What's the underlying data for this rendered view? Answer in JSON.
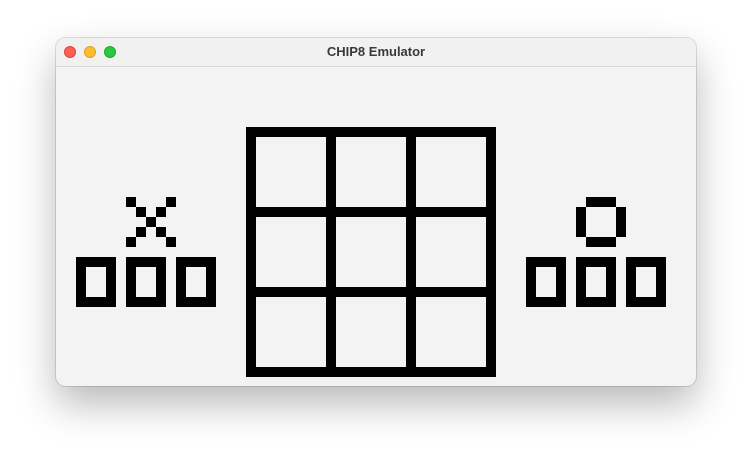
{
  "window": {
    "title": "CHIP8 Emulator"
  },
  "colors": {
    "pixel_on": "#000000",
    "pixel_off": "#f3f3f3",
    "close": "#fe5f57",
    "minimize": "#febc2e",
    "zoom": "#28c840"
  },
  "game": {
    "player_x_symbol": "X",
    "player_o_symbol": "O",
    "player_x_score_digits": [
      "0",
      "0",
      "0"
    ],
    "player_o_score_digits": [
      "0",
      "0",
      "0"
    ],
    "board_cells": [
      "",
      "",
      "",
      "",
      "",
      "",
      "",
      "",
      ""
    ]
  }
}
